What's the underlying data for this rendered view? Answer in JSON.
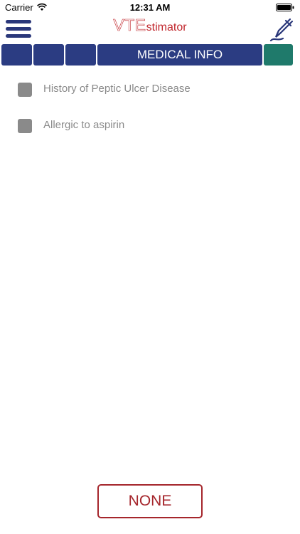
{
  "status_bar": {
    "carrier": "Carrier",
    "time": "12:31 AM"
  },
  "header": {
    "logo_vte": "VTE",
    "logo_stimator": "stimator",
    "menu_icon": "hamburger-menu-icon",
    "edit_icon": "pen-icon"
  },
  "tabs": {
    "active_label": "MEDICAL INFO"
  },
  "checklist": {
    "items": [
      {
        "label": "History of Peptic Ulcer Disease",
        "checked": false
      },
      {
        "label": "Allergic to aspirin",
        "checked": false
      }
    ]
  },
  "footer": {
    "none_label": "NONE"
  },
  "colors": {
    "brand_blue": "#2b3c82",
    "brand_red": "#c1272d",
    "accent_green": "#1f7a6b",
    "checkbox_gray": "#8a8a8a"
  }
}
